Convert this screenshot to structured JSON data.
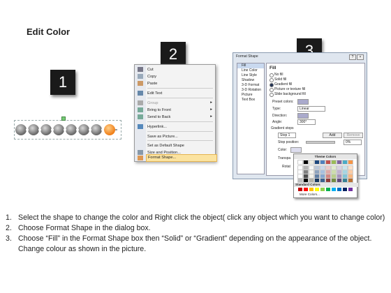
{
  "title": "Edit Color",
  "steps": [
    "1",
    "2",
    "3"
  ],
  "context_menu": {
    "items": [
      "Cut",
      "Copy",
      "Paste",
      "Edit Text",
      "Group",
      "Bring to Front",
      "Send to Back",
      "Hyperlink...",
      "Save as Picture...",
      "Set as Default Shape",
      "Size and Position...",
      "Format Shape..."
    ]
  },
  "dialog": {
    "title": "Format Shape",
    "categories": [
      "Fill",
      "Line Color",
      "Line Style",
      "Shadow",
      "3-D Format",
      "3-D Rotation",
      "Picture",
      "Text Box"
    ],
    "section": "Fill",
    "fill_options": [
      "No fill",
      "Solid fill",
      "Gradient fill",
      "Picture or texture fill",
      "Slide background fill"
    ],
    "preset_label": "Preset colors:",
    "type_label": "Type:",
    "type_value": "Linear",
    "direction_label": "Direction:",
    "angle_label": "Angle:",
    "angle_value": "300°",
    "gradient_stops_label": "Gradient stops",
    "stop_value": "Stop 1",
    "add_label": "Add",
    "remove_label": "Remove",
    "stop_position_label": "Stop position:",
    "stop_position_value": "0%",
    "color_label": "Color:",
    "transparency_label": "Transpa",
    "rotate_label": "Rotat",
    "close_symbol": "×",
    "help_symbol": "?"
  },
  "palette": {
    "theme_label": "Theme Colors",
    "standard_label": "Standard Colors",
    "more_label": "More Colors...",
    "theme_colors": [
      "#ffffff",
      "#000000",
      "#eeece1",
      "#1f497d",
      "#4f81bd",
      "#c0504d",
      "#9bbb59",
      "#8064a2",
      "#4bacc6",
      "#f79646"
    ],
    "standard_colors": [
      "#c00000",
      "#ff0000",
      "#ffc000",
      "#ffff00",
      "#92d050",
      "#00b050",
      "#00b0f0",
      "#0070c0",
      "#002060",
      "#7030a0"
    ]
  },
  "instructions": [
    {
      "num": "1.",
      "text": "Select the shape to change the color and Right click the object( click any object which you want to change color)"
    },
    {
      "num": "2.",
      "text": "Choose Format Shape in the dialog box."
    },
    {
      "num": "3.",
      "text": "Choose “Fill” in the Format Shape box then “Solid” or “Gradient” depending on the appearance of the object. Change colour as shown in the picture."
    }
  ]
}
